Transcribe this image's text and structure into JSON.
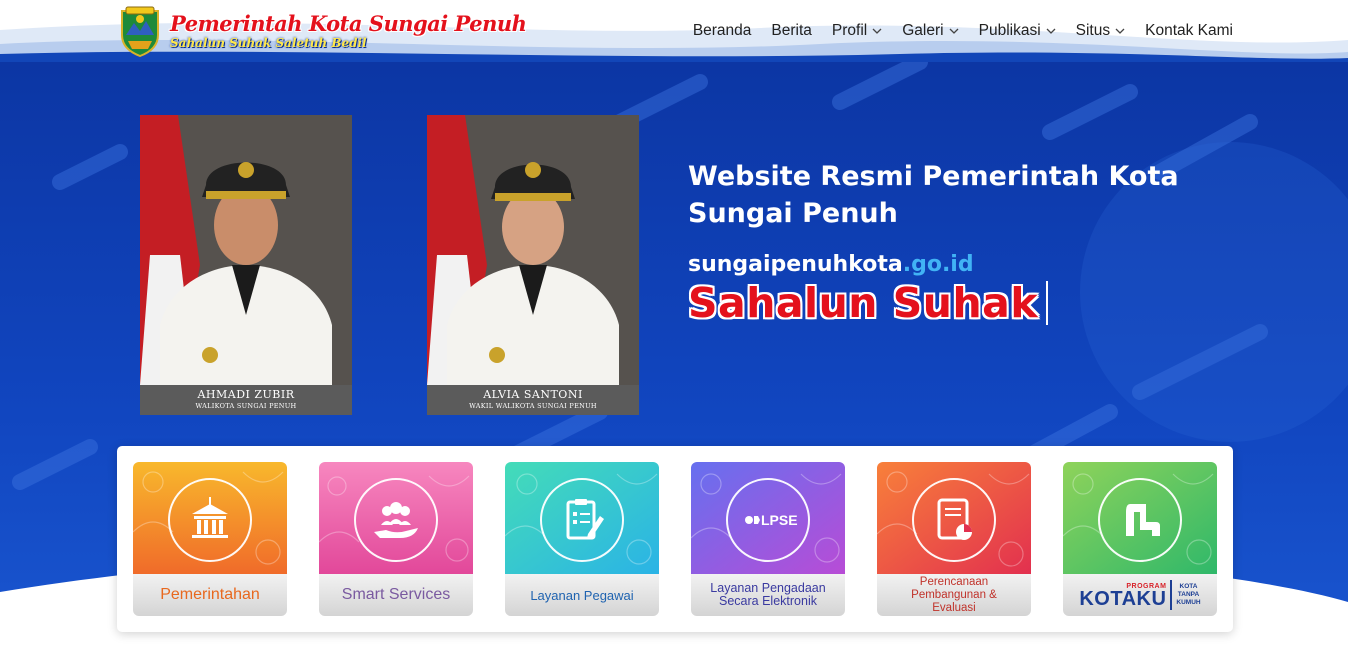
{
  "header": {
    "brand_title": "Pemerintah Kota Sungai Penuh",
    "brand_tagline": "Sahalun Suhak Saletuh Bedil",
    "nav": [
      {
        "label": "Beranda",
        "has_dropdown": false
      },
      {
        "label": "Berita",
        "has_dropdown": false
      },
      {
        "label": "Profil",
        "has_dropdown": true
      },
      {
        "label": "Galeri",
        "has_dropdown": true
      },
      {
        "label": "Publikasi",
        "has_dropdown": true
      },
      {
        "label": "Situs",
        "has_dropdown": true
      },
      {
        "label": "Kontak Kami",
        "has_dropdown": false
      }
    ]
  },
  "hero": {
    "title": "Website Resmi Pemerintah Kota Sungai Penuh",
    "domain_name": "sungaipenuhkota",
    "domain_tld": ".go.id",
    "typed_text": "Sahalun Suhak",
    "officials": [
      {
        "name": "AHMADI ZUBIR",
        "role": "WALIKOTA SUNGAI PENUH"
      },
      {
        "name": "ALVIA SANTONI",
        "role": "WAKIL WALIKOTA SUNGAI PENUH"
      }
    ]
  },
  "services": [
    {
      "label": "Pemerintahan",
      "icon": "government-building-icon",
      "color_top": "#f7b12b",
      "color_bottom": "#f06b2a",
      "label_color": "#e8681e"
    },
    {
      "label": "Smart Services",
      "icon": "people-hand-icon",
      "color_top": "#f77ab8",
      "color_bottom": "#e2489a",
      "label_color": "#7a5aa0"
    },
    {
      "label": "Layanan Pegawai",
      "icon": "clipboard-edit-icon",
      "color_top": "#3fd6c0",
      "color_bottom": "#2ab3e6",
      "label_color": "#1f63b0"
    },
    {
      "label": "Layanan Pengadaan Secara Elektronik",
      "icon": "lpse-icon",
      "icon_text": "LPSE",
      "color_top": "#6d6bf0",
      "color_bottom": "#b24bd6",
      "label_color": "#3a3aa0"
    },
    {
      "label": "Perencanaan Pembangunan & Evaluasi",
      "icon": "document-chart-icon",
      "color_top": "#f7773d",
      "color_bottom": "#e2304f",
      "label_color": "#c0322a"
    },
    {
      "label": "KOTAKU",
      "icon": "kotaku-logo-icon",
      "program_text": "PROGRAM",
      "sub_text": [
        "KOTA",
        "TANPA",
        "KUMUH"
      ],
      "color_top": "#59d07a",
      "color_bottom": "#2fb86a",
      "label_color": "#1d3f94"
    }
  ],
  "colors": {
    "hero_blue": "#0c36a4",
    "accent_red": "#e4111c",
    "domain_blue": "#41b3f5"
  }
}
